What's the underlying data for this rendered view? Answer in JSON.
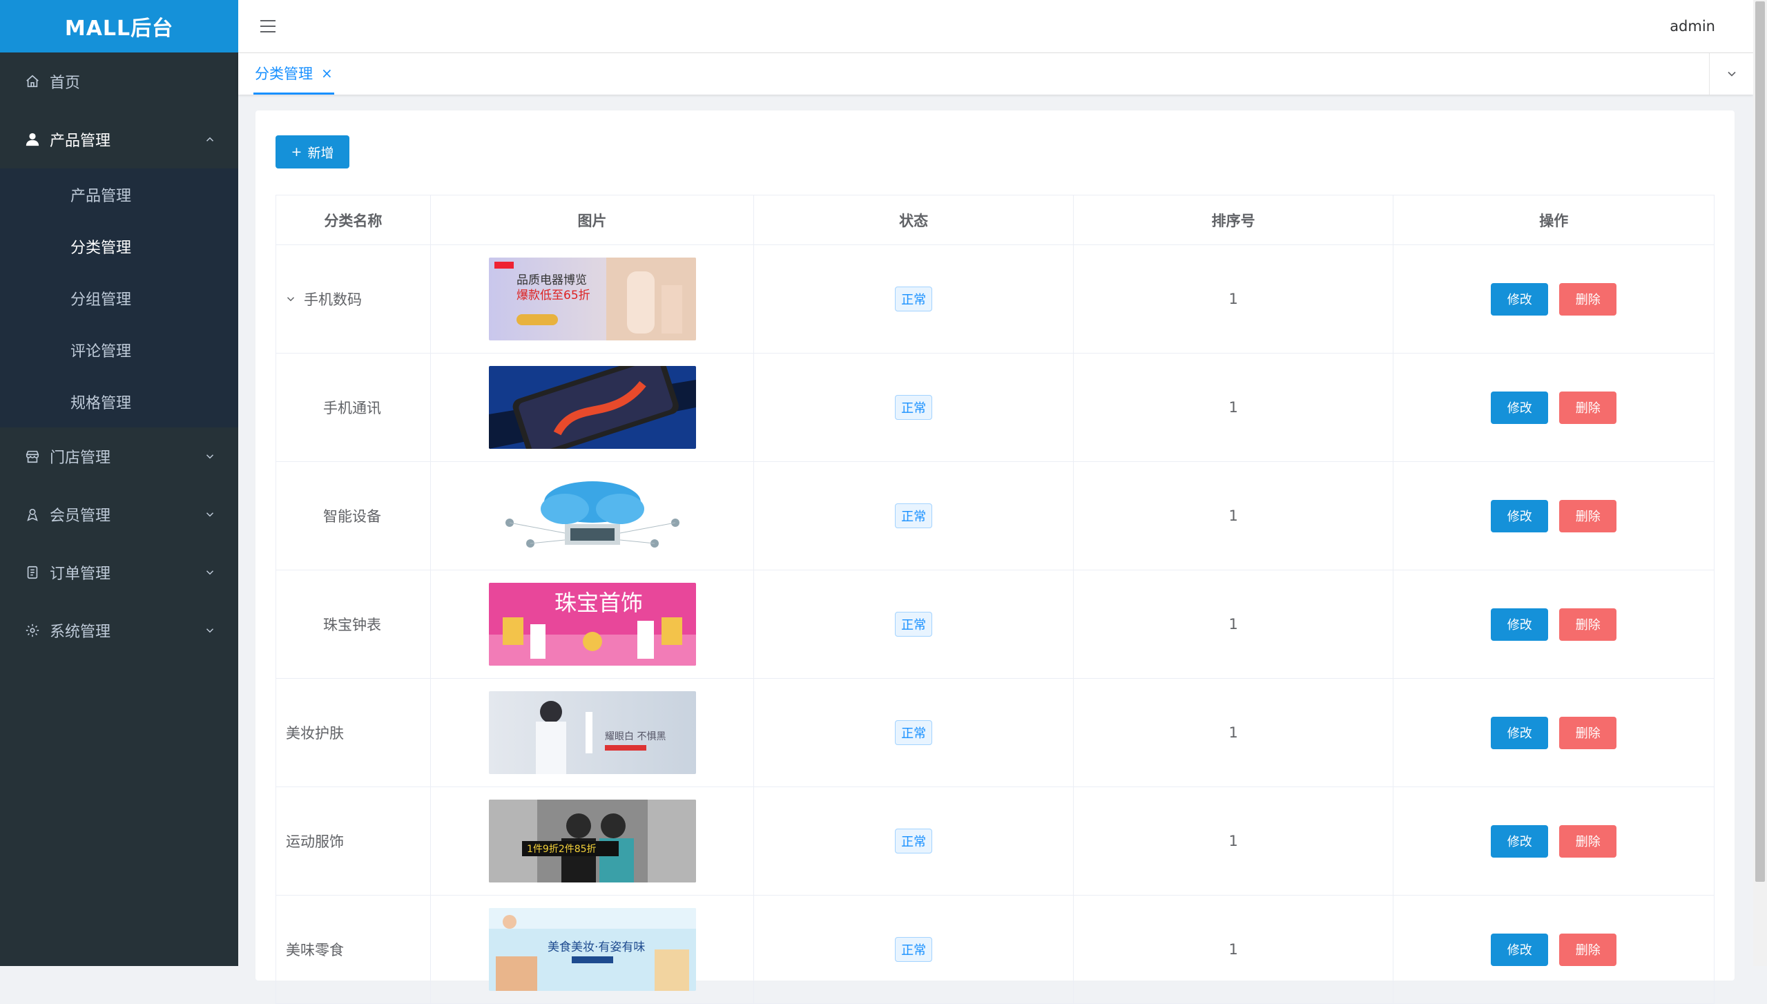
{
  "app": {
    "logo": "MALL后台",
    "user": "admin"
  },
  "colors": {
    "sidebar": "#263238",
    "accent": "#1591d9",
    "danger": "#f56c6c",
    "tab_active": "#1890ff"
  },
  "sidebar": {
    "home": {
      "label": "首页",
      "icon": "home-icon"
    },
    "product": {
      "label": "产品管理",
      "icon": "user-icon",
      "children": [
        {
          "label": "产品管理"
        },
        {
          "label": "分类管理",
          "active": true
        },
        {
          "label": "分组管理"
        },
        {
          "label": "评论管理"
        },
        {
          "label": "规格管理"
        }
      ]
    },
    "store": {
      "label": "门店管理",
      "icon": "store-icon"
    },
    "member": {
      "label": "会员管理",
      "icon": "member-icon"
    },
    "order": {
      "label": "订单管理",
      "icon": "order-icon"
    },
    "system": {
      "label": "系统管理",
      "icon": "settings-icon"
    }
  },
  "tabs": [
    {
      "label": "分类管理",
      "close": "×"
    }
  ],
  "toolbar": {
    "add_label": "新增",
    "add_icon": "+"
  },
  "table": {
    "headers": [
      "分类名称",
      "图片",
      "状态",
      "排序号",
      "操作"
    ],
    "edit_label": "修改",
    "delete_label": "删除",
    "rows": [
      {
        "name": "手机数码",
        "status": "正常",
        "sort": "1",
        "expandable": true,
        "image_text": "品质电器博览馆 爆款低至65折"
      },
      {
        "name": "手机通讯",
        "status": "正常",
        "sort": "1",
        "indent": true,
        "image_text": ""
      },
      {
        "name": "智能设备",
        "status": "正常",
        "sort": "1",
        "indent": true,
        "image_text": ""
      },
      {
        "name": "珠宝钟表",
        "status": "正常",
        "sort": "1",
        "indent": true,
        "image_text": "珠宝首饰"
      },
      {
        "name": "美妆护肤",
        "status": "正常",
        "sort": "1",
        "image_text": "耀眼白 不惧黑"
      },
      {
        "name": "运动服饰",
        "status": "正常",
        "sort": "1",
        "image_text": "1件9折2件85折"
      },
      {
        "name": "美味零食",
        "status": "正常",
        "sort": "1",
        "image_text": "美食美妆·有姿有味"
      }
    ]
  }
}
